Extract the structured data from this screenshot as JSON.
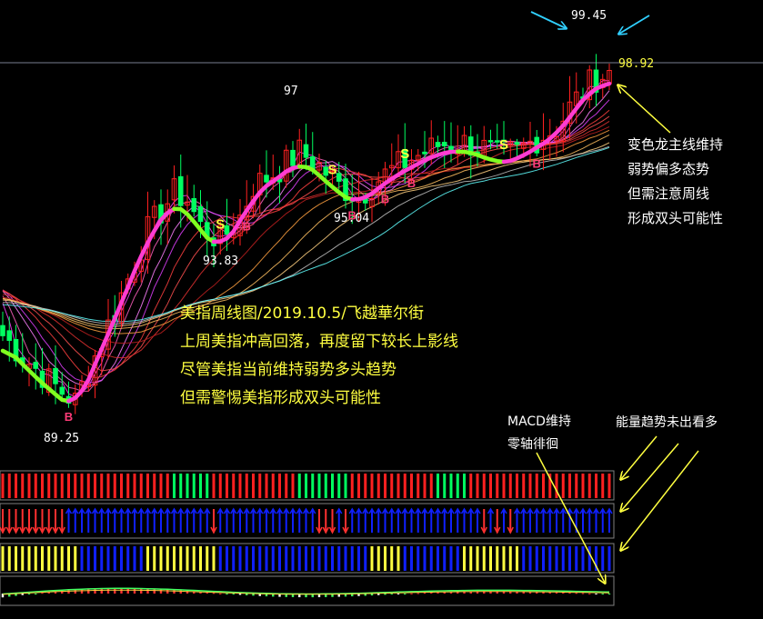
{
  "price_labels": {
    "peak": "99.45",
    "last": "98.92",
    "p97": "97",
    "low1": "93.83",
    "low2": "95.04",
    "bottom": "89.25"
  },
  "signals": {
    "buy": "B",
    "sell": "S"
  },
  "annotations": {
    "right_note": [
      "变色龙主线维持",
      "弱势偏多态势",
      "但需注意周线",
      "形成双头可能性"
    ],
    "main_note": [
      "美指周线图/2019.10.5/飞越華尔街",
      "上周美指冲高回落，再度留下较长上影线",
      "尽管美指当前维持弱势多头趋势",
      "但需警惕美指形成双头可能性"
    ],
    "macd_note": [
      "MACD维持",
      "零轴徘徊"
    ],
    "energy_note": "能量趋势未出看多"
  },
  "colors": {
    "background": "#000000",
    "up": "#ff2020",
    "down": "#00ff60",
    "main_line_bull": "#ff3cd2",
    "main_line_bear": "#80ff20",
    "label_yellow": "#ffff40",
    "arrow_cyan": "#30d0ff",
    "panel_blue": "#1020ff"
  },
  "chart_data": {
    "type": "candlestick",
    "title": "美指周线图/2019.10.5/飞越華尔街",
    "timeframe": "weekly",
    "ylim": [
      88.5,
      100.0
    ],
    "marked_levels": [
      {
        "label": "99.45",
        "value": 99.45,
        "kind": "high"
      },
      {
        "label": "98.92",
        "value": 98.92,
        "kind": "last"
      },
      {
        "label": "97",
        "value": 97.0,
        "kind": "high"
      },
      {
        "label": "95.04",
        "value": 95.04,
        "kind": "low"
      },
      {
        "label": "93.83",
        "value": 93.83,
        "kind": "low"
      },
      {
        "label": "89.25",
        "value": 89.25,
        "kind": "low"
      }
    ],
    "close_path": [
      [
        0,
        91.2
      ],
      [
        4,
        90.4
      ],
      [
        8,
        89.7
      ],
      [
        11,
        89.25
      ],
      [
        14,
        90.6
      ],
      [
        18,
        92.4
      ],
      [
        22,
        94.3
      ],
      [
        26,
        95.4
      ],
      [
        28,
        95.2
      ],
      [
        30,
        94.4
      ],
      [
        33,
        94.0
      ],
      [
        36,
        94.7
      ],
      [
        38,
        95.6
      ],
      [
        42,
        96.1
      ],
      [
        45,
        96.6
      ],
      [
        48,
        96.2
      ],
      [
        51,
        95.6
      ],
      [
        54,
        95.3
      ],
      [
        57,
        95.8
      ],
      [
        60,
        96.2
      ],
      [
        63,
        96.5
      ],
      [
        66,
        96.8
      ],
      [
        69,
        96.9
      ],
      [
        72,
        96.8
      ],
      [
        75,
        96.5
      ],
      [
        78,
        96.6
      ],
      [
        81,
        97.0
      ],
      [
        84,
        97.3
      ],
      [
        86,
        97.9
      ],
      [
        88,
        98.4
      ],
      [
        90,
        98.8
      ],
      [
        92,
        98.92
      ]
    ],
    "candle_count": 93,
    "sub_panels": [
      "volume-trend bars",
      "signal arrows",
      "energy bars",
      "MACD"
    ]
  }
}
